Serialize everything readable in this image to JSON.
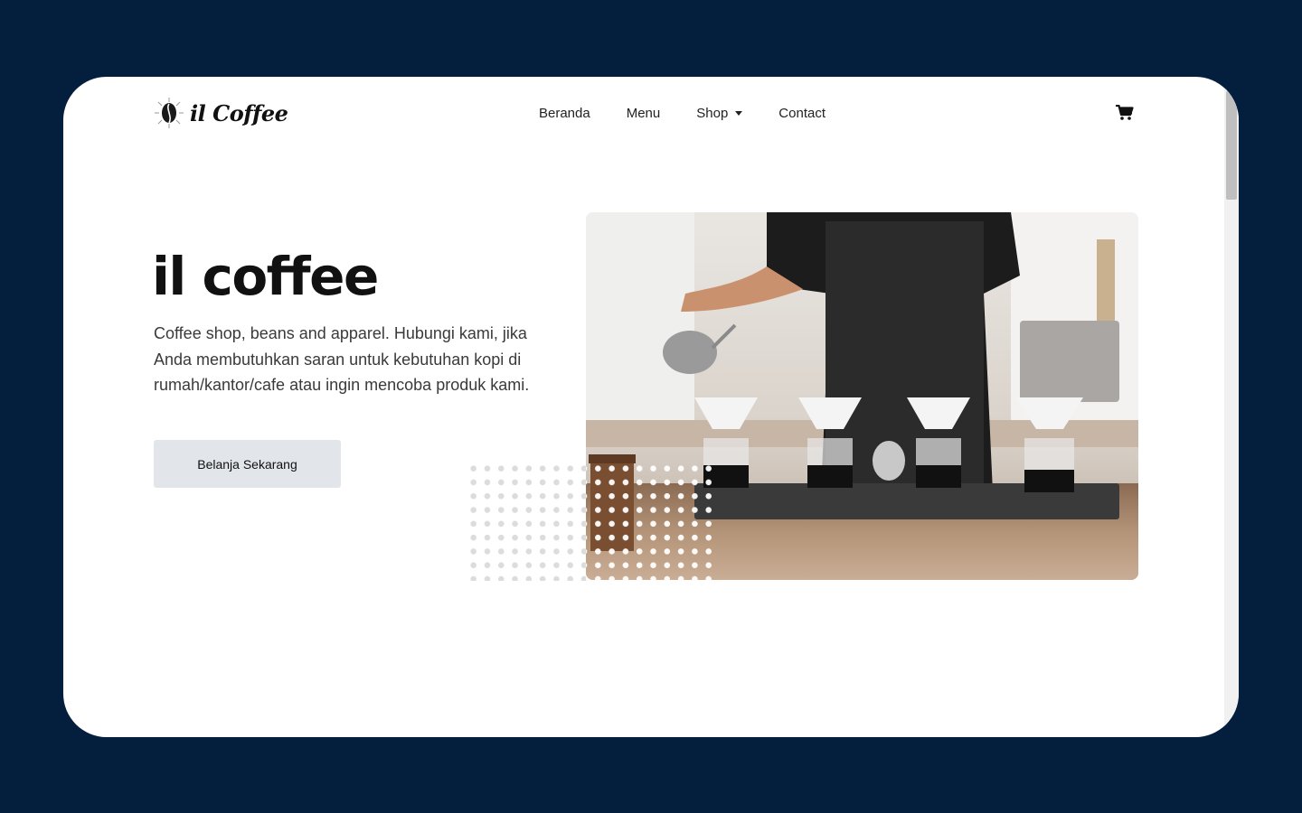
{
  "brand": {
    "name": "il Coffee"
  },
  "nav": {
    "items": [
      {
        "label": "Beranda"
      },
      {
        "label": "Menu"
      },
      {
        "label": "Shop",
        "has_dropdown": true
      },
      {
        "label": "Contact"
      }
    ],
    "cart_icon": "shopping-cart-icon"
  },
  "hero": {
    "title": "il coffee",
    "description": "Coffee shop, beans and apparel. Hubungi kami, jika Anda membutuhkan saran untuk kebutuhan kopi di rumah/kantor/cafe atau ingin mencoba produk kami.",
    "cta_label": "Belanja Sekarang"
  },
  "colors": {
    "page_background": "#041e3e",
    "card_background": "#ffffff",
    "button_background": "#e2e5ea",
    "text_primary": "#111111",
    "text_body": "#3a3a3a"
  }
}
